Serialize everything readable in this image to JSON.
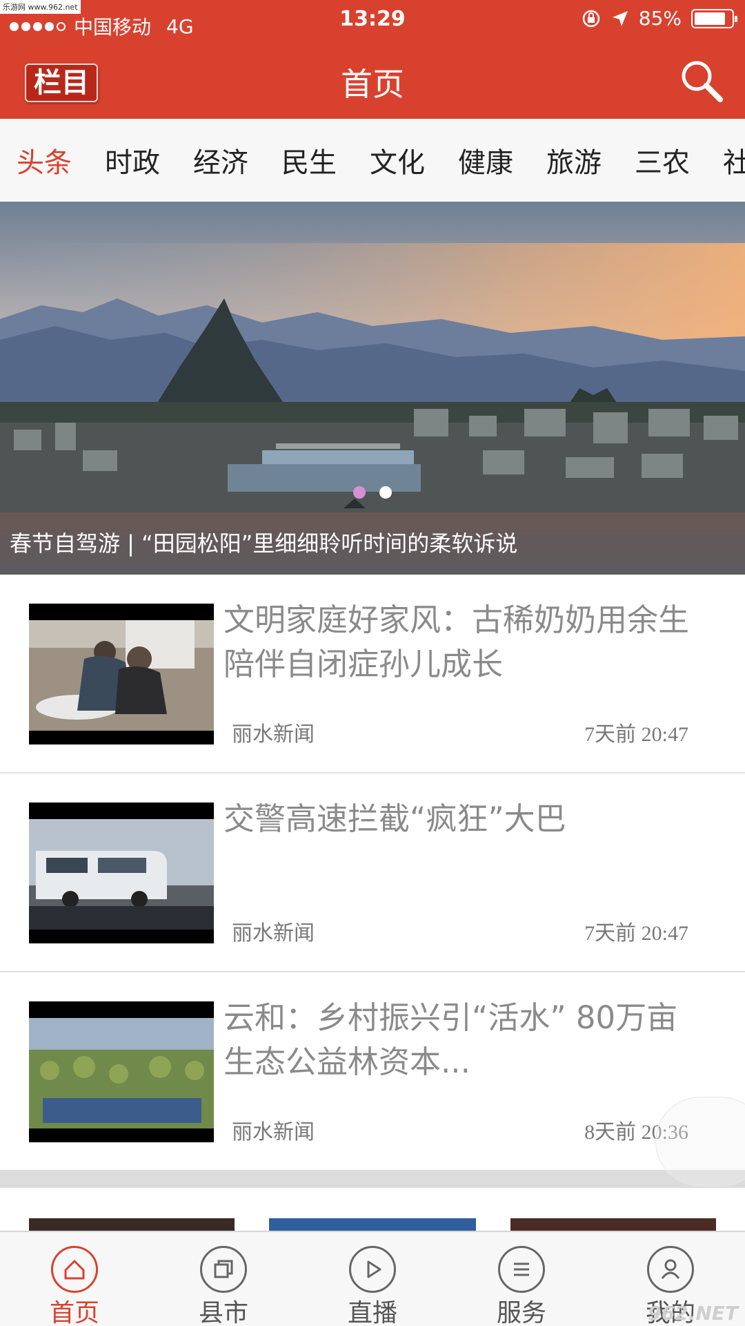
{
  "watermark_top": "乐游网 www.962.net",
  "status_bar": {
    "carrier": "中国移动",
    "network": "4G",
    "time": "13:29",
    "battery_percent": "85%",
    "battery_level": 0.85
  },
  "nav": {
    "menu_label": "栏目",
    "title": "首页",
    "search_icon": "search-icon"
  },
  "categories": {
    "active": 0,
    "items": [
      "头条",
      "时政",
      "经济",
      "民生",
      "文化",
      "健康",
      "旅游",
      "三农",
      "社"
    ]
  },
  "hero": {
    "caption": "春节自驾游 | “田园松阳”里细细聆听时间的柔软诉说",
    "slides": 2,
    "active_slide": 0
  },
  "news": [
    {
      "title": "文明家庭好家风：古稀奶奶用余生陪伴自闭症孙儿成长",
      "source": "丽水新闻",
      "time": "7天前 20:47"
    },
    {
      "title": "交警高速拦截“疯狂”大巴",
      "source": "丽水新闻",
      "time": "7天前 20:47"
    },
    {
      "title": "云和：乡村振兴引“活水” 80万亩生态公益林资本...",
      "source": "丽水新闻",
      "time": "8天前 20:36"
    }
  ],
  "tabbar": [
    {
      "label": "首页",
      "icon": "home-icon",
      "active": true
    },
    {
      "label": "县市",
      "icon": "copy-icon",
      "active": false
    },
    {
      "label": "直播",
      "icon": "play-icon",
      "active": false
    },
    {
      "label": "服务",
      "icon": "menu-icon",
      "active": false
    },
    {
      "label": "我的",
      "icon": "user-icon",
      "active": false
    }
  ],
  "watermark_bottom": "962.NET",
  "colors": {
    "brand": "#d9412f",
    "tab_active": "#d9412f",
    "text_muted": "#8a8a8a"
  }
}
